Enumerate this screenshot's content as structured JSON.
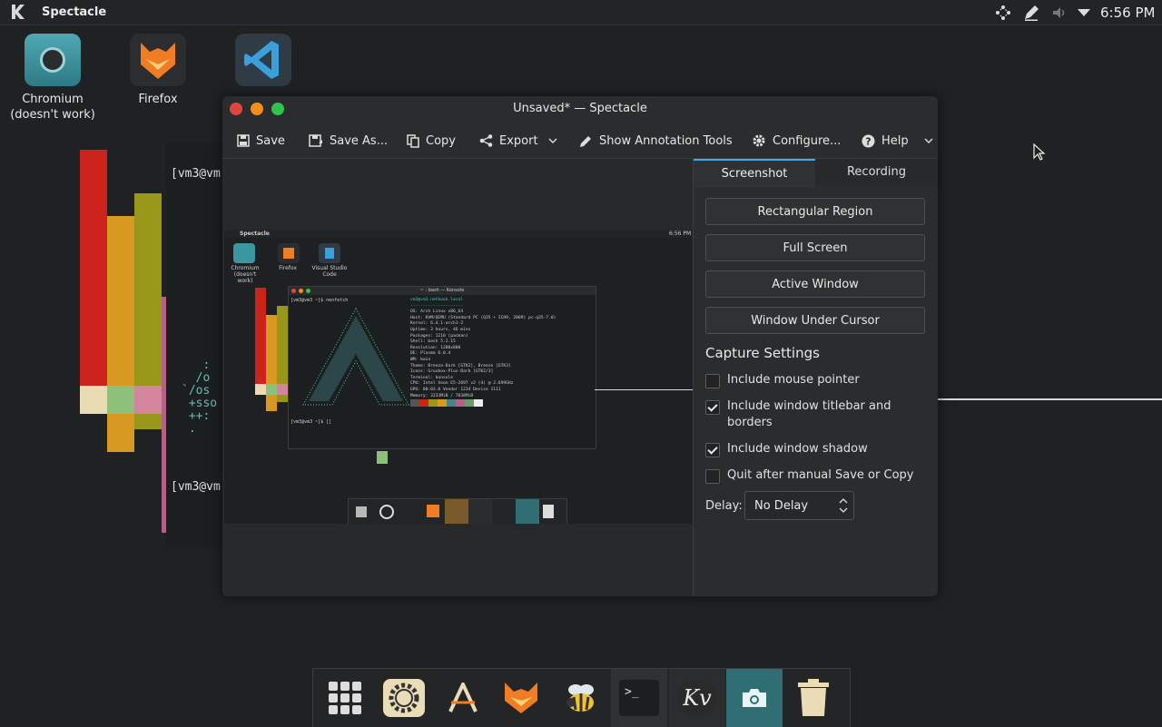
{
  "top_panel": {
    "app_name": "Spectacle",
    "clock": "6:56 PM",
    "tray_icons": [
      "network-icon",
      "pen-icon",
      "volume-icon",
      "expand-arrow-icon"
    ]
  },
  "desktop": {
    "icons": [
      {
        "label": "Chromium\n(doesn't work)",
        "icon": "chromium-icon"
      },
      {
        "label": "Firefox",
        "icon": "firefox-icon"
      },
      {
        "label": "",
        "icon": "vscode-icon"
      }
    ],
    "terminal_prompts": [
      "[vm3@vm",
      "[vm3@vm"
    ]
  },
  "window": {
    "title": "Unsaved* — Spectacle",
    "toolbar": {
      "save": "Save",
      "save_as": "Save As...",
      "copy": "Copy",
      "export": "Export",
      "annotation": "Show Annotation Tools",
      "configure": "Configure...",
      "help": "Help"
    },
    "tabs": [
      "Screenshot",
      "Recording"
    ],
    "capture_modes": [
      "Rectangular Region",
      "Full Screen",
      "Active Window",
      "Window Under Cursor"
    ],
    "capture_settings_title": "Capture Settings",
    "options": [
      {
        "label": "Include mouse pointer",
        "checked": false
      },
      {
        "label": "Include window titlebar and borders",
        "checked": true
      },
      {
        "label": "Include window shadow",
        "checked": true
      },
      {
        "label": "Quit after manual Save or Copy",
        "checked": false
      }
    ],
    "delay_label": "Delay:",
    "delay_value": "No Delay"
  },
  "preview": {
    "panel_app": "Spectacle",
    "panel_clock": "6:56 PM",
    "icons": [
      "Chromium\n(doesn't work)",
      "Firefox",
      "Visual Studio\nCode"
    ],
    "terminal_title": "~ : bash — Konsole",
    "prompt": "[vm3@vm3 ~]$ neofetch",
    "prompt_end": "[vm3@vm3 ~]$ []",
    "neofetch": [
      "vm3@vm3.netbook.local",
      "---------------------",
      "OS: Arch Linux x86_64",
      "Host: KVM/QEMU (Standard PC (Q35 + ICH9, 2009) pc-q35-7.0)",
      "Kernel: 6.4.1-arch1-2",
      "Uptime: 3 hours, 46 mins",
      "Packages: 1210 (pacman)",
      "Shell: bash 5.2.15",
      "Resolution: 1280x800",
      "DE: Plasma 6.0.4",
      "WM: kwin",
      "Theme: Breeze-Dark [GTK2], Breeze [GTK3]",
      "Icons: Gruvbox-Plus-Dark [GTK2/3]",
      "Terminal: konsole",
      "CPU: Intel Xeon E5-2697 v2 (4) @ 2.699GHz",
      "GPU: 00:03.0 Vendor 1234 Device 1111",
      "Memory: 3233MiB / 7838MiB"
    ]
  },
  "dock": {
    "items": [
      "app-grid-icon",
      "settings-icon",
      "text-editor-icon",
      "firefox-icon",
      "bee-icon",
      "terminal-icon",
      "kv-icon",
      "spectacle-icon",
      "trash-icon"
    ]
  },
  "colors": {
    "accent": "#3daee9",
    "bar_red": "#cc241d",
    "bar_orange": "#d79921",
    "bar_olive": "#98971a",
    "bar_pink": "#b16286",
    "terminal_cyan": "#5bbfc2"
  }
}
